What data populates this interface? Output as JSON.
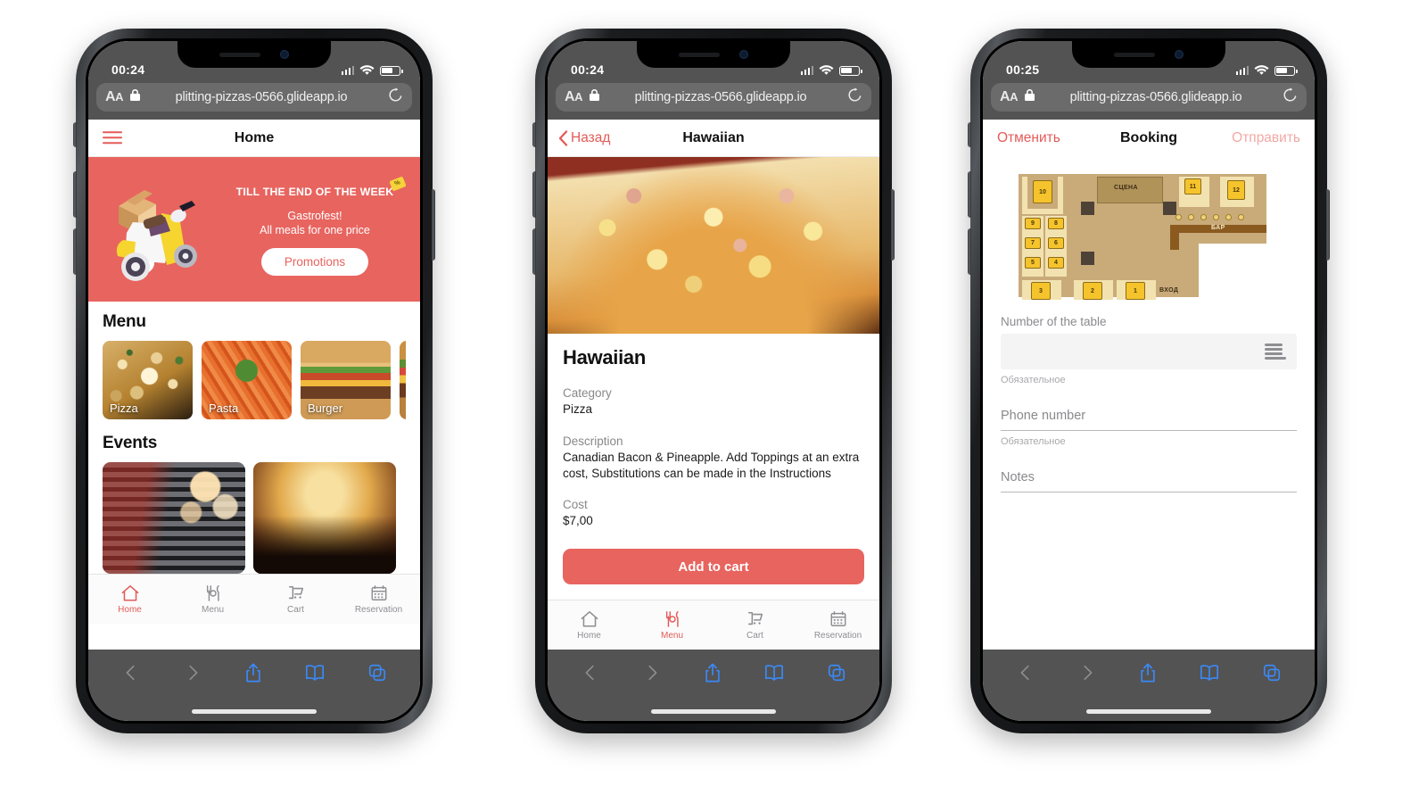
{
  "browser": {
    "aa_label": "AA",
    "url": "plitting-pizzas-0566.glideapp.io",
    "lock_icon": "lock-icon",
    "reload_icon": "reload-icon",
    "back_icon": "back-arrow-icon",
    "forward_icon": "forward-arrow-icon",
    "share_icon": "share-icon",
    "bookmarks_icon": "book-icon",
    "tabs_icon": "tabs-icon"
  },
  "phones": [
    {
      "id": "phone-home",
      "status": {
        "time": "00:24",
        "signal_icon": "cellular-bars-icon",
        "wifi_icon": "wifi-icon",
        "battery_icon": "battery-icon"
      },
      "app": {
        "nav": {
          "menu_icon": "hamburger-icon",
          "title": "Home"
        },
        "promo": {
          "headline": "TILL THE END OF THE WEEK",
          "tag": "%",
          "line1": "Gastrofest!",
          "line2": "All meals for one price",
          "cta": "Promotions",
          "art_icon": "scooter-delivery-icon",
          "bg_color": "#e8645f"
        },
        "menu_section": {
          "title": "Menu",
          "cards": [
            {
              "label": "Pizza",
              "image": "pizza-photo"
            },
            {
              "label": "Pasta",
              "image": "pasta-photo"
            },
            {
              "label": "Burger",
              "image": "burger-photo"
            },
            {
              "label": "",
              "image": "burger-photo-2"
            }
          ]
        },
        "events_section": {
          "title": "Events",
          "cards": [
            {
              "label": "",
              "image": "microphone-photo"
            },
            {
              "label": "",
              "image": "concert-crowd-photo"
            }
          ]
        },
        "tabs": [
          {
            "label": "Home",
            "icon": "home-icon",
            "active": true
          },
          {
            "label": "Menu",
            "icon": "cutlery-icon",
            "active": false
          },
          {
            "label": "Cart",
            "icon": "cart-icon",
            "active": false
          },
          {
            "label": "Reservation",
            "icon": "calendar-icon",
            "active": false
          }
        ]
      }
    },
    {
      "id": "phone-detail",
      "status": {
        "time": "00:24",
        "signal_icon": "cellular-bars-icon",
        "wifi_icon": "wifi-icon",
        "battery_icon": "battery-icon"
      },
      "app": {
        "nav": {
          "back_label": "Назад",
          "back_icon": "chevron-left-icon",
          "title": "Hawaiian"
        },
        "hero_image": "hawaiian-pizza-photo",
        "product": {
          "name": "Hawaiian",
          "category_label": "Category",
          "category_value": "Pizza",
          "description_label": "Description",
          "description_value": "Canadian Bacon & Pineapple. Add Toppings at an extra cost, Substitutions can be made in the Instructions",
          "cost_label": "Cost",
          "cost_value": "$7,00",
          "add_to_cart": "Add to cart"
        },
        "tabs": [
          {
            "label": "Home",
            "icon": "home-icon",
            "active": false
          },
          {
            "label": "Menu",
            "icon": "cutlery-icon",
            "active": true
          },
          {
            "label": "Cart",
            "icon": "cart-icon",
            "active": false
          },
          {
            "label": "Reservation",
            "icon": "calendar-icon",
            "active": false
          }
        ]
      }
    },
    {
      "id": "phone-booking",
      "status": {
        "time": "00:25",
        "signal_icon": "cellular-bars-icon",
        "wifi_icon": "wifi-icon",
        "battery_icon": "battery-icon"
      },
      "app": {
        "nav": {
          "cancel": "Отменить",
          "title": "Booking",
          "submit": "Отправить"
        },
        "floorplan": {
          "stage_label": "СЦЕНА",
          "bar_label": "БАР",
          "entrance_label": "ВХОД",
          "tables": [
            "10",
            "9",
            "8",
            "7",
            "6",
            "5",
            "4",
            "3",
            "2",
            "1",
            "11",
            "12"
          ]
        },
        "form": {
          "table_label": "Number of the table",
          "table_value": "",
          "table_required": "Обязательное",
          "table_picker_icon": "list-lines-icon",
          "phone_placeholder": "Phone number",
          "phone_required": "Обязательное",
          "notes_placeholder": "Notes"
        }
      }
    }
  ]
}
